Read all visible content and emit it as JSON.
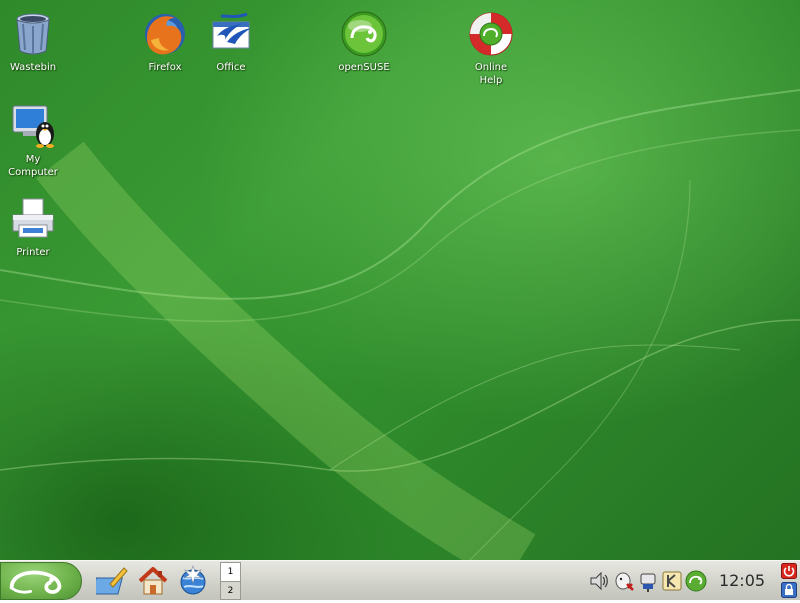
{
  "desktop": {
    "icons": [
      {
        "id": "wastebin",
        "label": "Wastebin",
        "icon": "trash-can-icon"
      },
      {
        "id": "firefox",
        "label": "Firefox",
        "icon": "firefox-icon"
      },
      {
        "id": "office",
        "label": "Office",
        "icon": "openoffice-icon"
      },
      {
        "id": "opensuse",
        "label": "openSUSE",
        "icon": "opensuse-gecko-icon"
      },
      {
        "id": "online-help",
        "label": "Online\nHelp",
        "icon": "lifebuoy-icon"
      },
      {
        "id": "my-computer",
        "label": "My\nComputer",
        "icon": "computer-tux-icon"
      },
      {
        "id": "printer",
        "label": "Printer",
        "icon": "printer-icon"
      }
    ]
  },
  "taskbar": {
    "pager": {
      "desktops": [
        "1",
        "2"
      ],
      "active": "1"
    },
    "clock": "12:05"
  },
  "colors": {
    "desktop_green": "#2f8a2a",
    "suse_green": "#6fb34c",
    "taskbar_gray": "#cfd0c8"
  }
}
